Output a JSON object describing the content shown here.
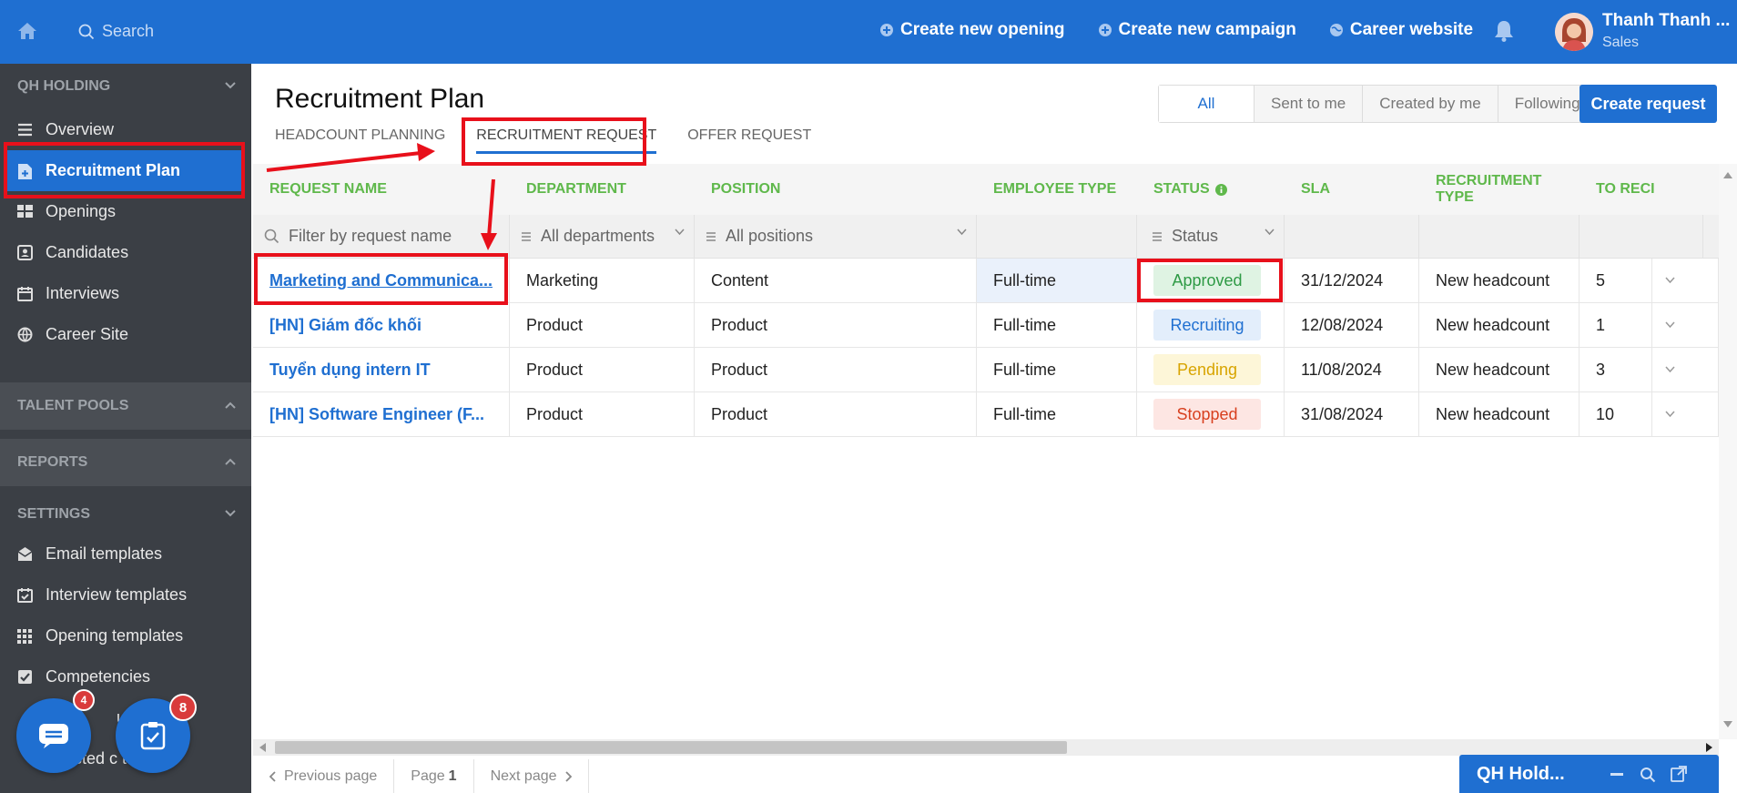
{
  "topbar": {
    "search_placeholder": "Search",
    "actions": [
      "Create new opening",
      "Create new campaign",
      "Career website"
    ],
    "user_name": "Thanh Thanh ...",
    "user_role": "Sales"
  },
  "sidebar": {
    "org": "QH HOLDING",
    "items": [
      "Overview",
      "Recruitment Plan",
      "Openings",
      "Candidates",
      "Interviews",
      "Career Site"
    ],
    "talent_pools": "TALENT POOLS",
    "reports": "REPORTS",
    "settings": "SETTINGS",
    "settings_items": [
      "Email templates",
      "Interview templates",
      "Opening templates",
      "Competencies",
      "Disqualifications",
      "Blacklisted contacts"
    ],
    "settings_items_visible": [
      "Email templates",
      "Interview templates",
      "Opening templates",
      "Competencies",
      "ue Q",
      "cklisted c ts"
    ]
  },
  "fab": {
    "chat_badge": "4",
    "tasks_badge": "8"
  },
  "page": {
    "title": "Recruitment Plan",
    "tabs": [
      "HEADCOUNT PLANNING",
      "RECRUITMENT REQUEST",
      "OFFER REQUEST"
    ],
    "filters": [
      "All",
      "Sent to me",
      "Created by me",
      "Following"
    ],
    "create_button": "Create request"
  },
  "table": {
    "columns": [
      "REQUEST NAME",
      "DEPARTMENT",
      "POSITION",
      "EMPLOYEE TYPE",
      "STATUS",
      "SLA",
      "RECRUITMENT TYPE",
      "TO RECI"
    ],
    "filter_placeholders": {
      "name": "Filter by request name",
      "department": "All departments",
      "position": "All positions",
      "status": "Status"
    },
    "rows": [
      {
        "name": "Marketing and Communica...",
        "department": "Marketing",
        "position": "Content",
        "type": "Full-time",
        "status": "Approved",
        "sla": "31/12/2024",
        "rtype": "New headcount",
        "count": "5"
      },
      {
        "name": "[HN] Giám đốc khối",
        "department": "Product",
        "position": "Product",
        "type": "Full-time",
        "status": "Recruiting",
        "sla": "12/08/2024",
        "rtype": "New headcount",
        "count": "1"
      },
      {
        "name": "Tuyển dụng intern IT",
        "department": "Product",
        "position": "Product",
        "type": "Full-time",
        "status": "Pending",
        "sla": "11/08/2024",
        "rtype": "New headcount",
        "count": "3"
      },
      {
        "name": "[HN] Software Engineer (F...",
        "department": "Product",
        "position": "Product",
        "type": "Full-time",
        "status": "Stopped",
        "sla": "31/08/2024",
        "rtype": "New headcount",
        "count": "10"
      }
    ],
    "status_colors": {
      "Approved": {
        "bg": "#dff3e3",
        "fg": "#2e9a45"
      },
      "Recruiting": {
        "bg": "#e3eefb",
        "fg": "#1f6fd1"
      },
      "Pending": {
        "bg": "#fdf6d8",
        "fg": "#d8a400"
      },
      "Stopped": {
        "bg": "#fde6e3",
        "fg": "#d8401f"
      }
    }
  },
  "pager": {
    "prev": "Previous page",
    "page_label": "Page",
    "page_number": "1",
    "next": "Next page"
  },
  "chat_widget": {
    "title": "QH Hold..."
  }
}
